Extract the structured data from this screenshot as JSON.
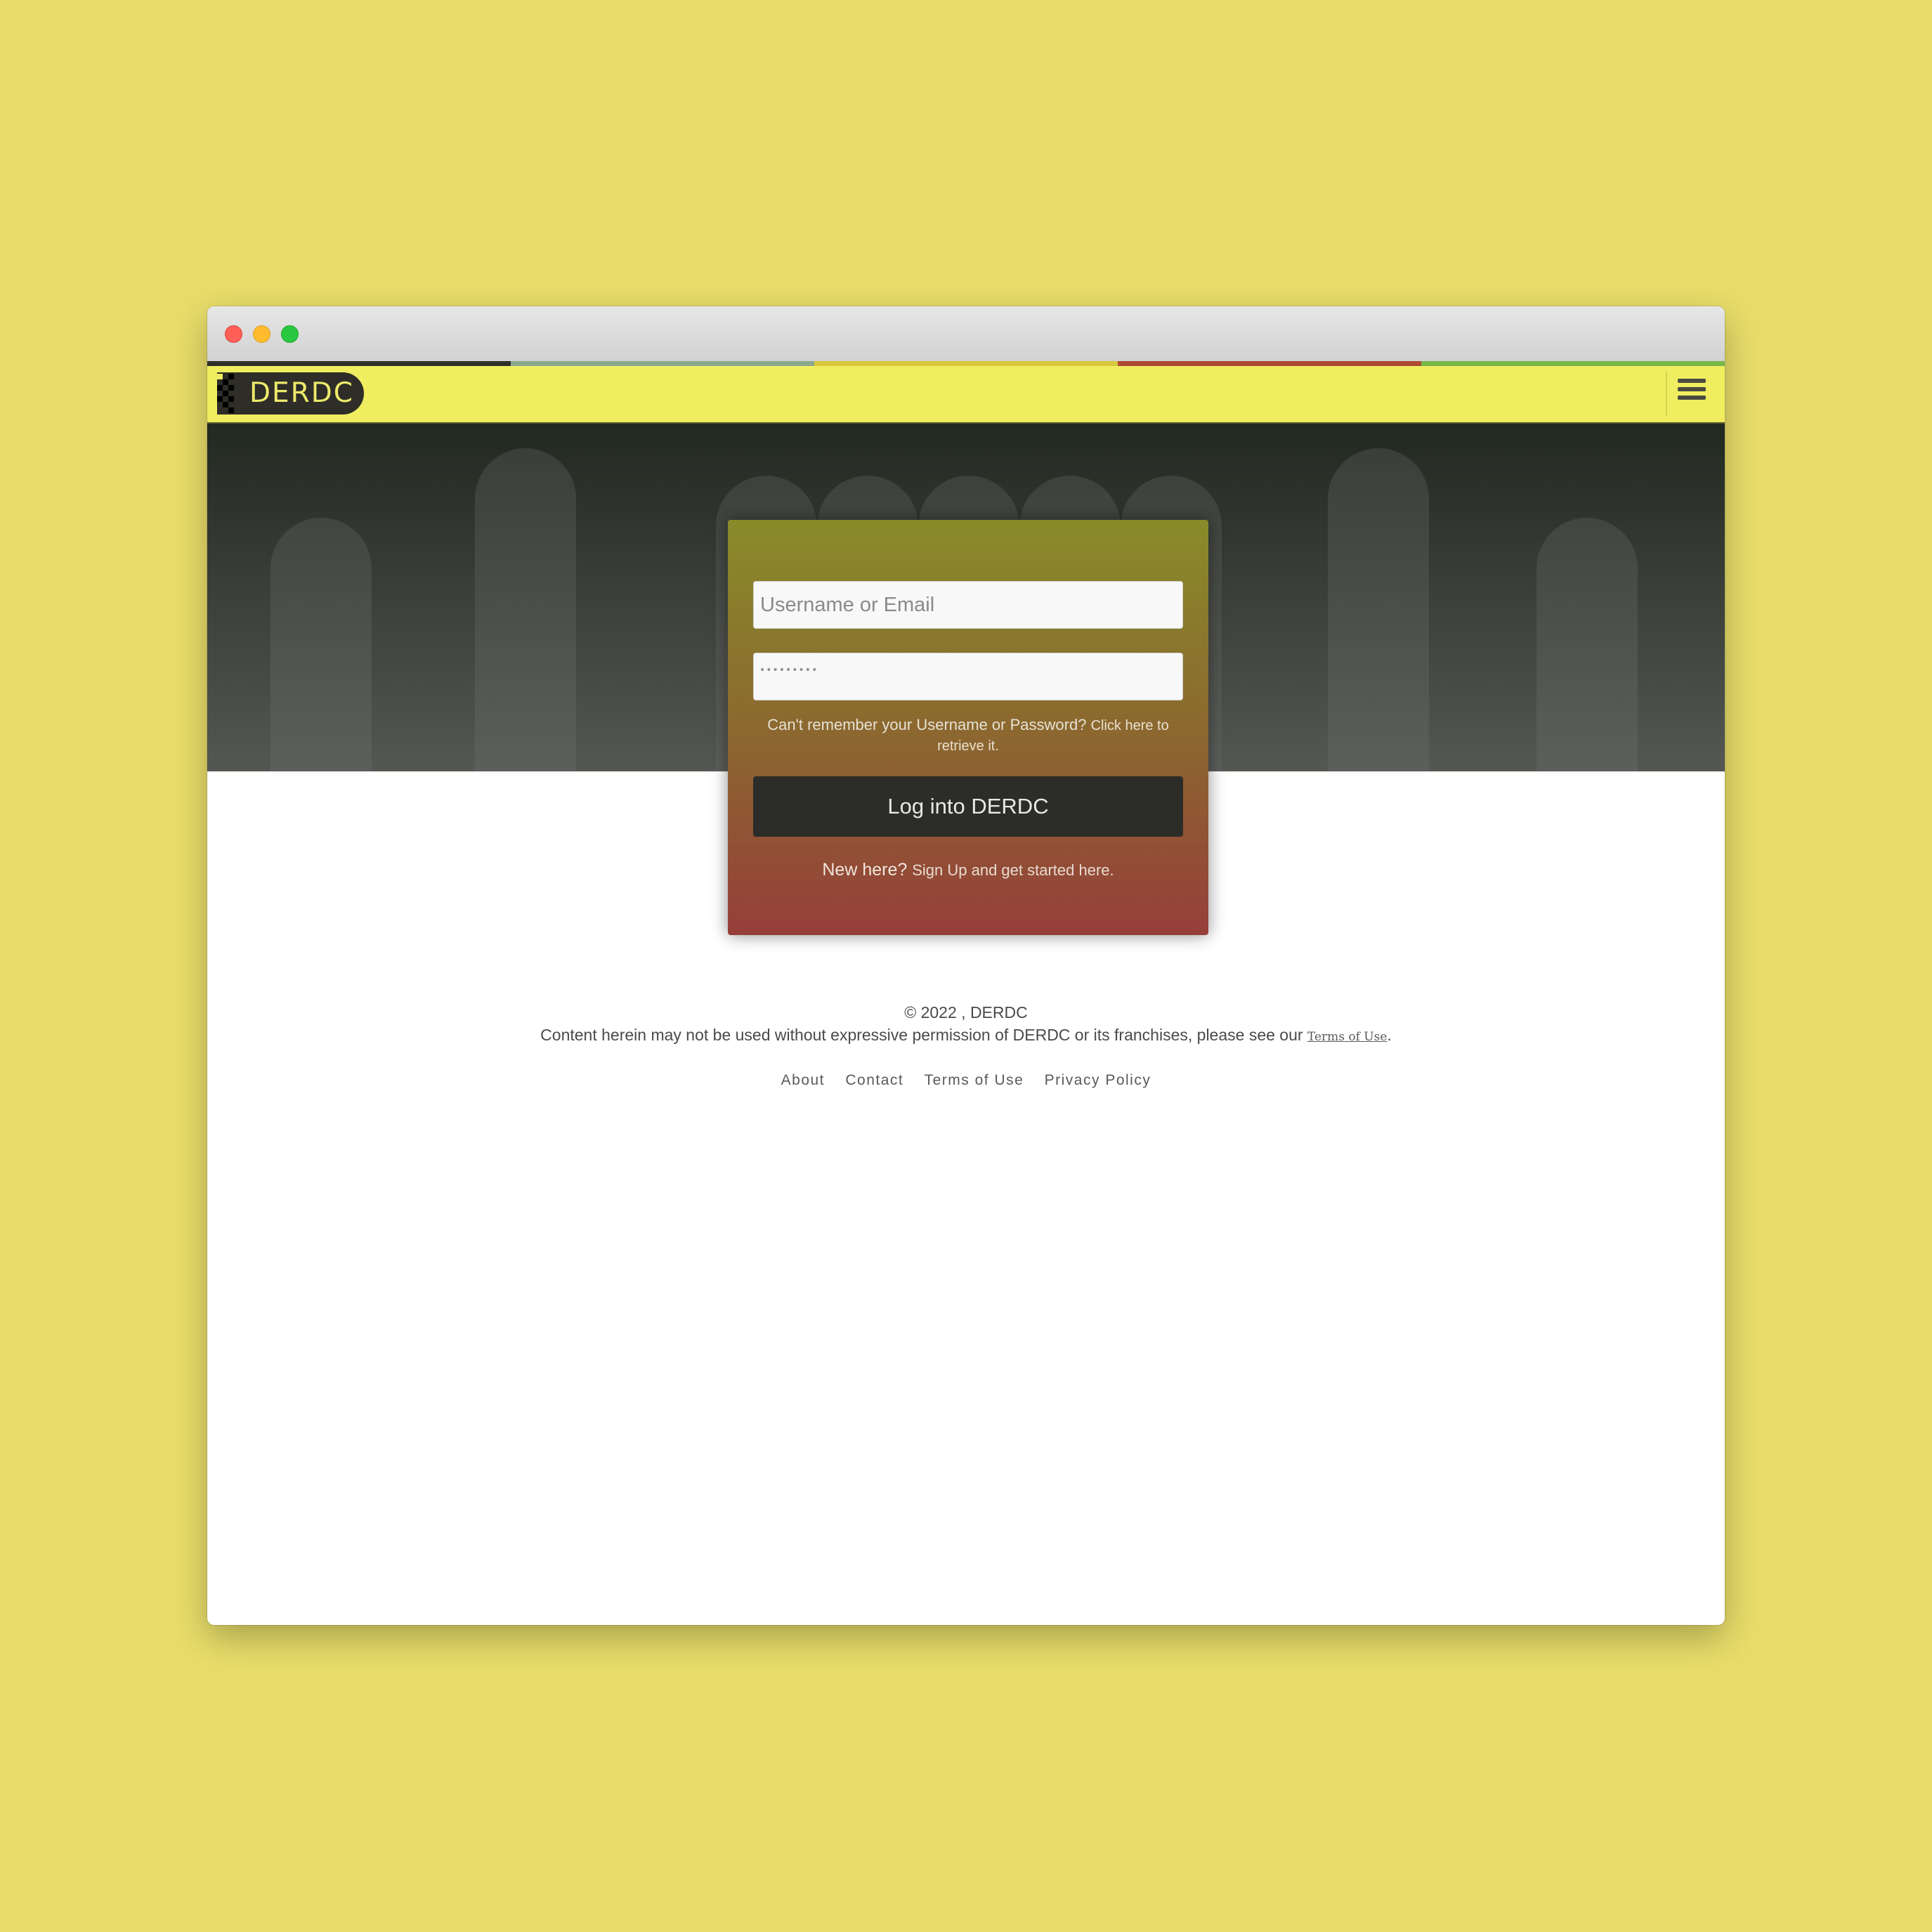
{
  "colors": {
    "page_background": "#e8dd6a",
    "navbar": "#f0ee60",
    "brand_background": "#2e2d28",
    "brand_text": "#ecea6a",
    "strip": [
      "#2f2f2b",
      "#8aa88c",
      "#d6c83a",
      "#b04a32",
      "#7ab648"
    ],
    "button": "#2c2c28"
  },
  "brand": {
    "name": "DERDC",
    "logo_icon": "pixel-stair-icon"
  },
  "nav": {
    "menu_icon": "hamburger-menu-icon"
  },
  "login": {
    "username_placeholder": "Username or Email",
    "password_value": "•••••••••",
    "forgot_prefix": "Can't remember your Username or Password?",
    "forgot_link": "Click here to retrieve it.",
    "submit_label": "Log into DERDC",
    "signup_prefix": "New here?",
    "signup_link": "Sign Up and get started here."
  },
  "footer": {
    "copyright": "© 2022 , DERDC",
    "notice": "Content herein may not be used without expressive permission of DERDC or its franchises, please see our",
    "terms_link": "Terms of Use",
    "period": ".",
    "links": [
      "About",
      "Contact",
      "Terms of Use",
      "Privacy Policy"
    ]
  }
}
